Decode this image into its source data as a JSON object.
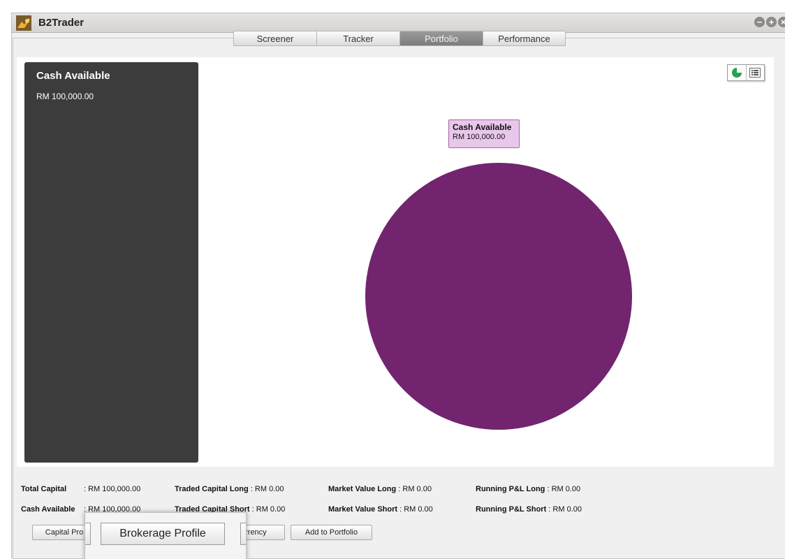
{
  "app": {
    "title": "B2Trader"
  },
  "tabs": [
    {
      "label": "Screener",
      "active": false
    },
    {
      "label": "Tracker",
      "active": false
    },
    {
      "label": "Portfolio",
      "active": true
    },
    {
      "label": "Performance",
      "active": false
    }
  ],
  "cash_panel": {
    "title": "Cash Available",
    "value": "RM 100,000.00"
  },
  "chart_data": {
    "type": "pie",
    "slices": [
      {
        "label": "Cash Available",
        "value": 100000,
        "display": "RM 100,000.00",
        "color": "#72246e"
      }
    ],
    "tooltip": {
      "title": "Cash Available",
      "value": "RM 100,000.00"
    }
  },
  "view_toggle": {
    "pie_icon": "pie-chart-icon",
    "list_icon": "list-icon"
  },
  "summary": {
    "total_capital": {
      "label": "Total Capital",
      "value": ": RM 100,000.00"
    },
    "cash_available": {
      "label": "Cash Available",
      "value": ": RM 100,000.00"
    },
    "traded_capital_long": {
      "label": "Traded Capital Long",
      "value": ": RM 0.00"
    },
    "traded_capital_short": {
      "label": "Traded Capital Short",
      "value": ": RM 0.00"
    },
    "market_value_long": {
      "label": "Market Value Long",
      "value": ": RM 0.00"
    },
    "market_value_short": {
      "label": "Market Value Short",
      "value": ": RM 0.00"
    },
    "running_pl_long": {
      "label": "Running P&L Long",
      "value": ": RM 0.00"
    },
    "running_pl_short": {
      "label": "Running P&L Short",
      "value": ": RM 0.00"
    }
  },
  "buttons": {
    "capital_profile": "Capital Pro",
    "brokerage_profile": "Brokerage Profile",
    "currency": "urrency",
    "add_to_portfolio": "Add to Portfolio"
  },
  "colors": {
    "accent": "#72246e",
    "panel": "#3c3c3c",
    "tooltip_bg": "#e9c7ea"
  }
}
